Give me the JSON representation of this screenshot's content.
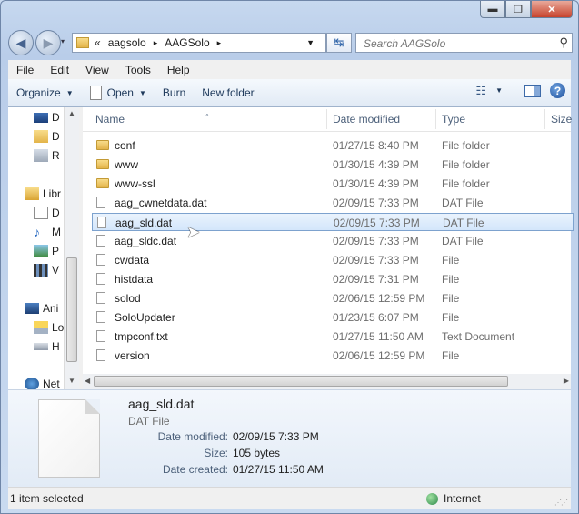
{
  "window": {
    "controls": {
      "minimize": "▬",
      "maximize": "❐",
      "close": "✕"
    }
  },
  "nav": {
    "back_glyph": "◀",
    "forward_glyph": "▶",
    "history_glyph": "▾",
    "address": {
      "overflow": "«",
      "segments": [
        "aagsolo",
        "AAGSolo"
      ],
      "separator": "▸"
    },
    "refresh_glyph": "↹",
    "search": {
      "placeholder": "Search AAGSolo"
    }
  },
  "menu": [
    "File",
    "Edit",
    "View",
    "Tools",
    "Help"
  ],
  "toolbar": {
    "organize": "Organize",
    "open": "Open",
    "burn": "Burn",
    "new_folder": "New folder",
    "help": "?"
  },
  "navpane": {
    "items": [
      {
        "label": "D",
        "icon": "desktop-icon"
      },
      {
        "label": "D",
        "icon": "downloads-icon"
      },
      {
        "label": "R",
        "icon": "recent-places-icon"
      },
      {
        "label": "Libr",
        "icon": "libraries-icon"
      },
      {
        "label": "D",
        "icon": "documents-icon"
      },
      {
        "label": "M",
        "icon": "music-icon"
      },
      {
        "label": "P",
        "icon": "pictures-icon"
      },
      {
        "label": "V",
        "icon": "videos-icon"
      },
      {
        "label": "Ani",
        "icon": "computer-icon"
      },
      {
        "label": "Lo",
        "icon": "local-disk-icon"
      },
      {
        "label": "H",
        "icon": "drive-icon"
      },
      {
        "label": "Net",
        "icon": "network-icon"
      }
    ]
  },
  "columns": {
    "name": "Name",
    "date": "Date modified",
    "type": "Type",
    "size": "Size",
    "sort_glyph": "^"
  },
  "files": [
    {
      "name": "conf",
      "date": "01/27/15 8:40 PM",
      "type": "File folder",
      "kind": "folder"
    },
    {
      "name": "www",
      "date": "01/30/15 4:39 PM",
      "type": "File folder",
      "kind": "folder"
    },
    {
      "name": "www-ssl",
      "date": "01/30/15 4:39 PM",
      "type": "File folder",
      "kind": "folder"
    },
    {
      "name": "aag_cwnetdata.dat",
      "date": "02/09/15 7:33 PM",
      "type": "DAT File",
      "kind": "file"
    },
    {
      "name": "aag_sld.dat",
      "date": "02/09/15 7:33 PM",
      "type": "DAT File",
      "kind": "file",
      "selected": true
    },
    {
      "name": "aag_sldc.dat",
      "date": "02/09/15 7:33 PM",
      "type": "DAT File",
      "kind": "file"
    },
    {
      "name": "cwdata",
      "date": "02/09/15 7:33 PM",
      "type": "File",
      "kind": "file"
    },
    {
      "name": "histdata",
      "date": "02/09/15 7:31 PM",
      "type": "File",
      "kind": "file"
    },
    {
      "name": "solod",
      "date": "02/06/15 12:59 PM",
      "type": "File",
      "kind": "file"
    },
    {
      "name": "SoloUpdater",
      "date": "01/23/15 6:07 PM",
      "type": "File",
      "kind": "file"
    },
    {
      "name": "tmpconf.txt",
      "date": "01/27/15 11:50 AM",
      "type": "Text Document",
      "kind": "file"
    },
    {
      "name": "version",
      "date": "02/06/15 12:59 PM",
      "type": "File",
      "kind": "file"
    }
  ],
  "details": {
    "name": "aag_sld.dat",
    "type": "DAT File",
    "fields": [
      {
        "label": "Date modified:",
        "value": "02/09/15 7:33 PM"
      },
      {
        "label": "Size:",
        "value": "105 bytes"
      },
      {
        "label": "Date created:",
        "value": "01/27/15 11:50 AM"
      }
    ]
  },
  "status": {
    "selection": "1 item selected",
    "zone": "Internet"
  },
  "colors": {
    "selection": "#d3e6fb",
    "accent": "#1e395b",
    "folder": "#e3b44a"
  }
}
